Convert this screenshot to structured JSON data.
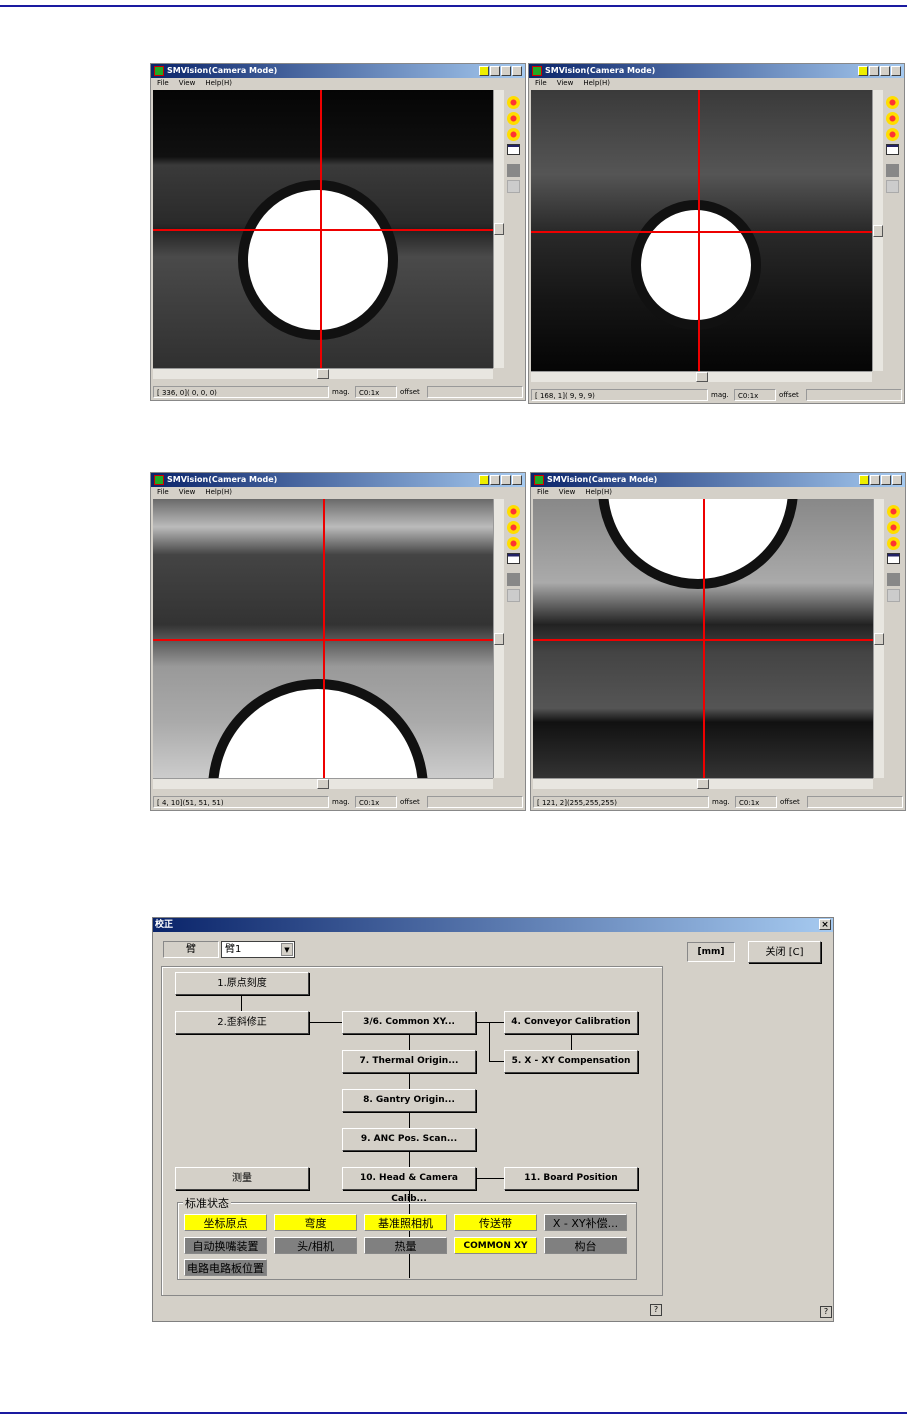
{
  "colors": {
    "rule": "#1a1aa0",
    "titlebar": "#0a246a",
    "crosshair": "#e00000",
    "status_ok": "#ffff00",
    "status_off": "#808080"
  },
  "camera_windows": [
    {
      "title": "SMVision(Camera Mode)",
      "menu": [
        "File",
        "View",
        "Help(H)"
      ],
      "coords": "[ 336,   0]( 0,  0,  0)",
      "mag_label": "mag.",
      "mag": "C0:1x",
      "offset_label": "offset"
    },
    {
      "title": "SMVision(Camera Mode)",
      "menu": [
        "File",
        "View",
        "Help(H)"
      ],
      "coords": "[ 168,   1]( 9,  9,  9)",
      "mag_label": "mag.",
      "mag": "C0:1x",
      "offset_label": "offset"
    },
    {
      "title": "SMVision(Camera Mode)",
      "menu": [
        "File",
        "View",
        "Help(H)"
      ],
      "coords": "[   4,  10](51, 51, 51)",
      "mag_label": "mag.",
      "mag": "C0:1x",
      "offset_label": "offset"
    },
    {
      "title": "SMVision(Camera Mode)",
      "menu": [
        "File",
        "View",
        "Help(H)"
      ],
      "coords": "[ 121,   2](255,255,255)",
      "mag_label": "mag.",
      "mag": "C0:1x",
      "offset_label": "offset"
    }
  ],
  "toolbar_icons": [
    "zoom-in-icon",
    "zoom-out-icon",
    "zoom-fit-icon",
    "window-icon",
    "gray-square-icon",
    "tool-icon"
  ],
  "dialog": {
    "title": "校正",
    "close": "×",
    "arm_label": "臂",
    "arm_value": "臂1",
    "unit": "[mm]",
    "close_button": "关闭 [C]",
    "buttons": {
      "origin": "1.原点刻度",
      "skew": "2.歪斜修正",
      "common_xy": "3/6. Common XY...",
      "conveyor": "4. Conveyor Calibration",
      "xy_comp": "5. X - XY Compensation",
      "thermal": "7. Thermal Origin...",
      "gantry": "8. Gantry Origin...",
      "anc": "9. ANC Pos. Scan...",
      "measure": "测量",
      "head_cam": "10. Head & Camera Calib...",
      "board": "11. Board Position"
    },
    "status_group": "标准状态",
    "status": [
      {
        "label": "坐标原点",
        "state": "ok"
      },
      {
        "label": "弯度",
        "state": "ok"
      },
      {
        "label": "基准照相机",
        "state": "ok"
      },
      {
        "label": "传送带",
        "state": "ok"
      },
      {
        "label": "X - XY补偿...",
        "state": "off"
      },
      {
        "label": "自动换嘴装置",
        "state": "off"
      },
      {
        "label": "头/相机",
        "state": "off"
      },
      {
        "label": "热量",
        "state": "off"
      },
      {
        "label": "COMMON XY",
        "state": "ok"
      },
      {
        "label": "构台",
        "state": "off"
      },
      {
        "label": "电路电路板位置",
        "state": "off"
      }
    ],
    "help": "?"
  }
}
